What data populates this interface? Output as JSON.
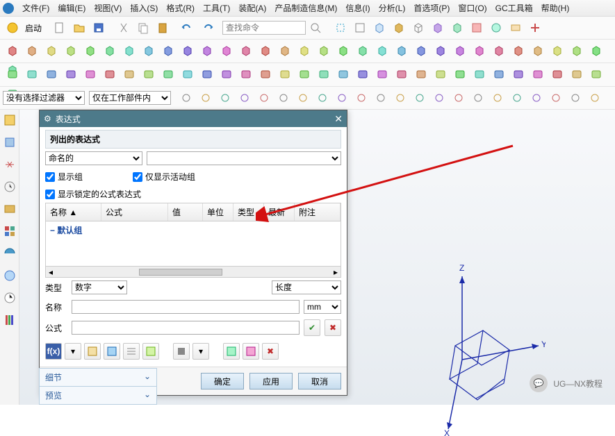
{
  "menu": {
    "items": [
      "文件(F)",
      "编辑(E)",
      "视图(V)",
      "插入(S)",
      "格式(R)",
      "工具(T)",
      "装配(A)",
      "产品制造信息(M)",
      "信息(I)",
      "分析(L)",
      "首选项(P)",
      "窗口(O)",
      "GC工具箱",
      "帮助(H)"
    ]
  },
  "toolbar1": {
    "start_label": "启动",
    "search_placeholder": "查找命令"
  },
  "filter": {
    "selection_filter": "没有选择过滤器",
    "scope": "仅在工作部件内"
  },
  "dialog": {
    "title": "表达式",
    "section_list": "列出的表达式",
    "named_filter": "命名的",
    "cb_show_group": "显示组",
    "cb_show_active_group": "仅显示活动组",
    "cb_show_locked_formula": "显示锁定的公式表达式",
    "grid": {
      "cols": [
        "名称 ▲",
        "公式",
        "值",
        "单位",
        "类型",
        "最新",
        "附注"
      ],
      "default_group": "默认组"
    },
    "type_label": "类型",
    "type_value": "数字",
    "measure_value": "长度",
    "name_label": "名称",
    "unit_value": "mm",
    "formula_label": "公式",
    "btn_ok": "确定",
    "btn_apply": "应用",
    "btn_cancel": "取消"
  },
  "panel": {
    "tab_detail": "细节",
    "tab_preview": "预览"
  },
  "axes": {
    "x": "X",
    "y": "Y",
    "z": "Z"
  },
  "watermark": "UG—NX教程",
  "colors": {
    "accent": "#4d7a8a",
    "arrow": "#d31111"
  }
}
